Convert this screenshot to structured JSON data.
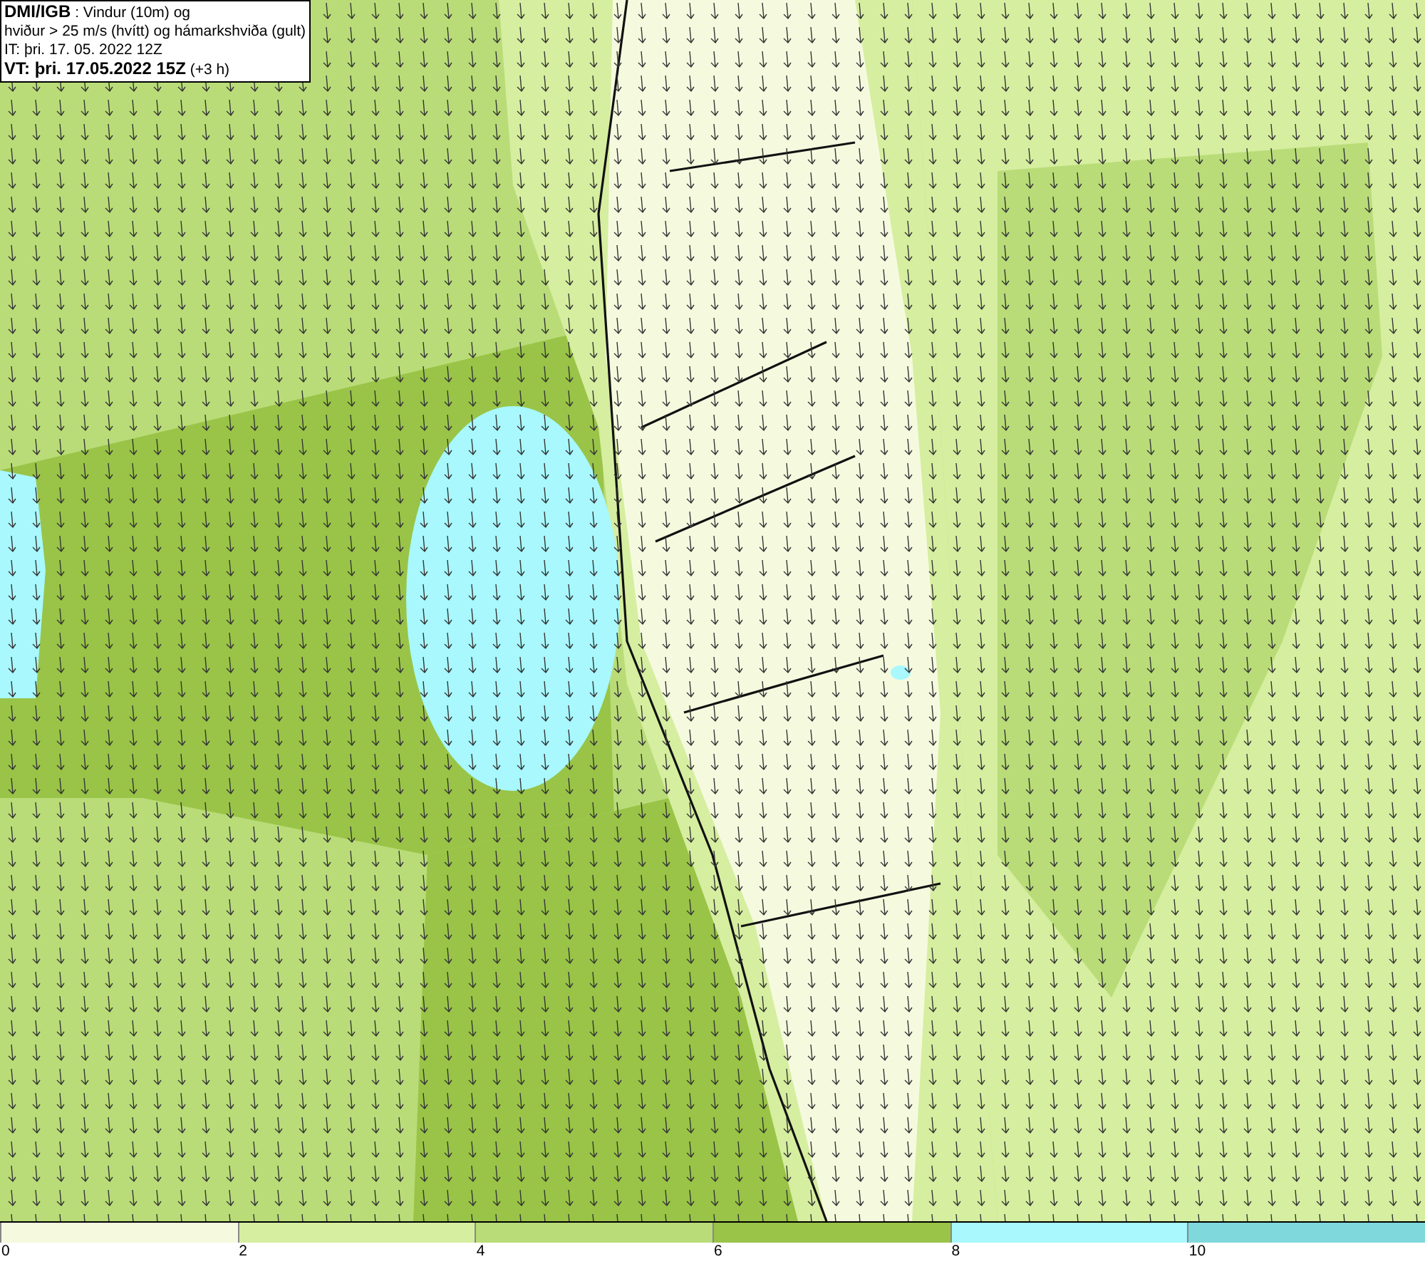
{
  "title_box": {
    "lines": [
      "**DMI/IGB** : Vindur (10m) og",
      "hviður > 25 m/s (hvítt) og hámarkshviða (gult)",
      "IT: þri. 17. 05. 2022 12Z",
      "**VT: þri. 17.05.2022 15Z** (+3 h)"
    ]
  },
  "legend": {
    "bins": [
      {
        "label": "0",
        "color": "#f5fadf"
      },
      {
        "label": "2",
        "color": "#d6eea0"
      },
      {
        "label": "4",
        "color": "#b9dc78"
      },
      {
        "label": "6",
        "color": "#99c447"
      },
      {
        "label": "8",
        "color": "#a8f8fd"
      },
      {
        "label": "10",
        "color": "#7fd9dc"
      }
    ]
  }
}
